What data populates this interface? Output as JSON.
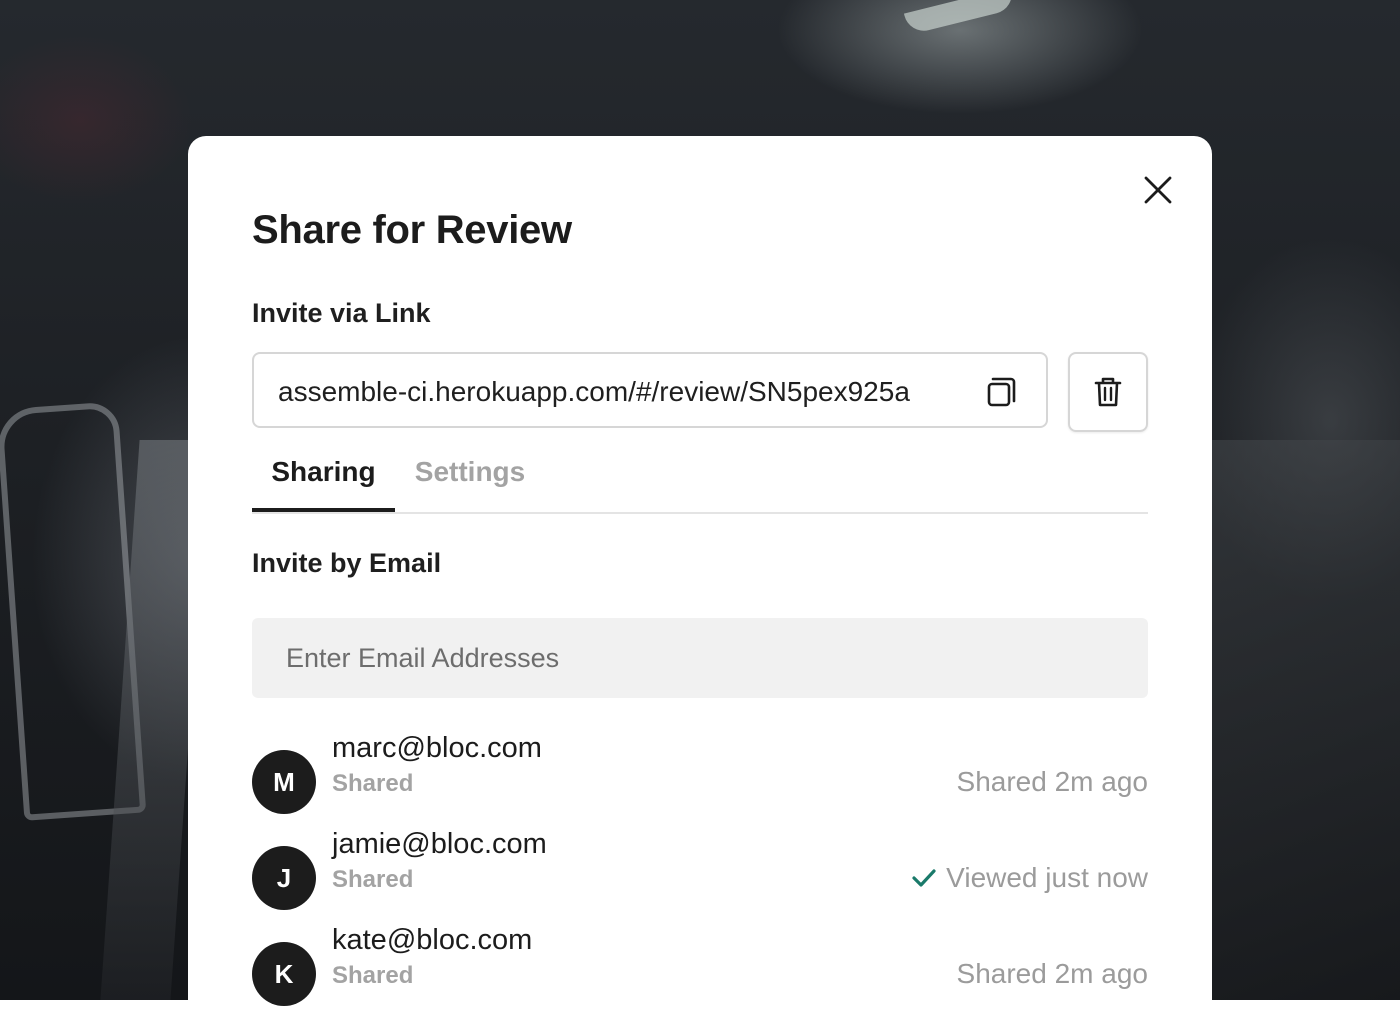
{
  "modal": {
    "title": "Share for Review",
    "close_icon": "close-icon"
  },
  "invite_link": {
    "label": "Invite via Link",
    "url": "assemble-ci.herokuapp.com/#/review/SN5pex925a",
    "copy_icon": "copy-icon",
    "delete_icon": "trash-icon"
  },
  "tabs": [
    {
      "label": "Sharing",
      "active": true
    },
    {
      "label": "Settings",
      "active": false
    }
  ],
  "invite_email": {
    "label": "Invite by Email",
    "placeholder": "Enter Email Addresses"
  },
  "shared_users": [
    {
      "initial": "M",
      "email": "marc@bloc.com",
      "status": "Shared",
      "activity": "Shared 2m ago",
      "viewed": false
    },
    {
      "initial": "J",
      "email": "jamie@bloc.com",
      "status": "Shared",
      "activity": "Viewed just now",
      "viewed": true
    },
    {
      "initial": "K",
      "email": "kate@bloc.com",
      "status": "Shared",
      "activity": "Shared 2m ago",
      "viewed": false
    }
  ],
  "colors": {
    "primary_text": "#1c1c1c",
    "muted_text": "#a3a3a3",
    "viewed_check": "#1a7a6a",
    "input_bg": "#f1f1f1"
  }
}
